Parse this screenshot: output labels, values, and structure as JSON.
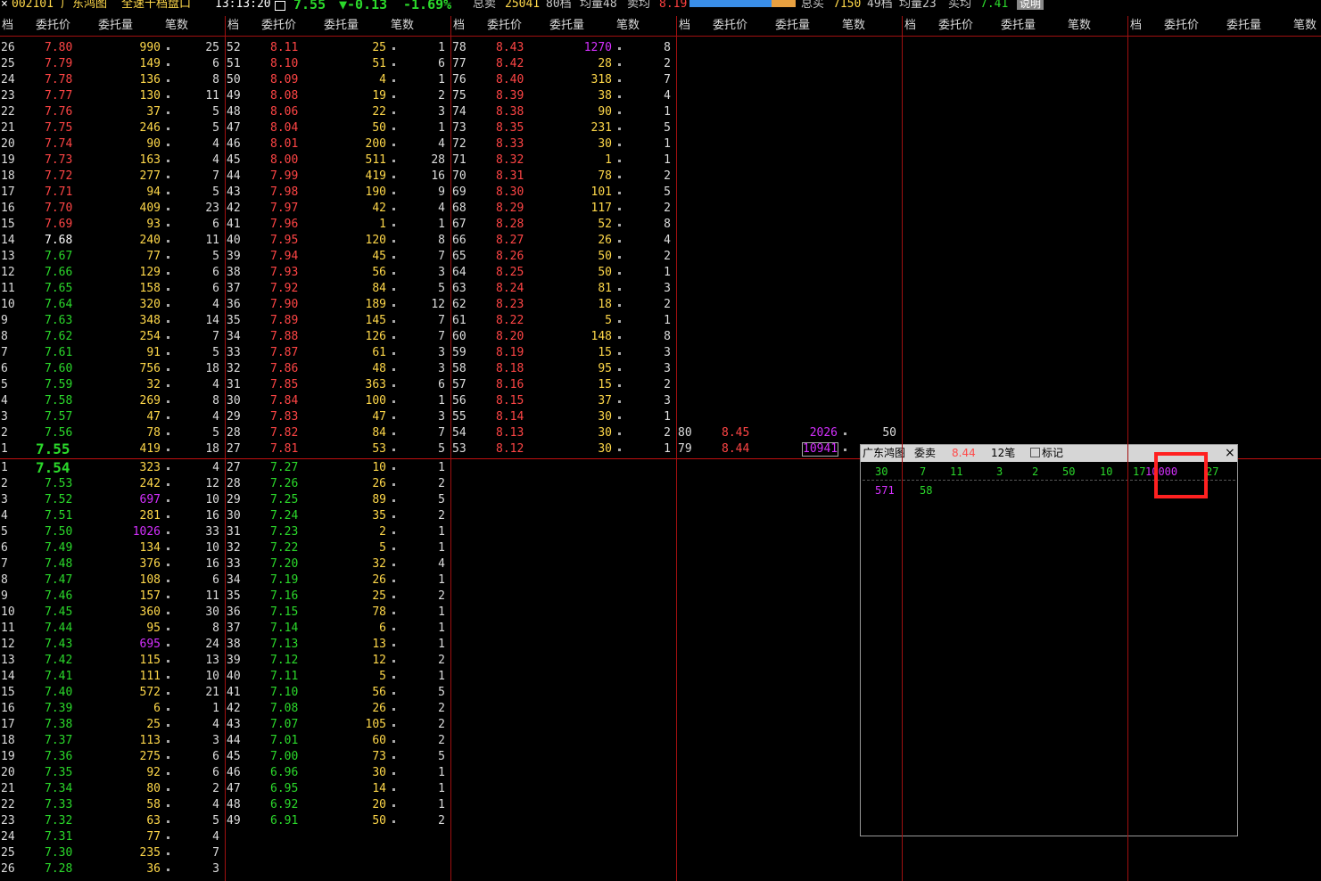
{
  "topbar": {
    "close_glyph": "×",
    "code": "002101",
    "name": "广东鸿图",
    "mode": "全速十档盘口",
    "time": "13:13:20",
    "camera_icon": "camera-icon",
    "price": "7.55",
    "change": "▼-0.13",
    "pct": "-1.69%",
    "sell_label": "总卖",
    "sell_total": "25041",
    "sell_levels": "80档",
    "sell_avg_label": "均量48",
    "sell_avg_price_label": "卖均",
    "sell_avg_price": "8.19",
    "buy_label": "总买",
    "buy_total": "7150",
    "buy_levels": "49档",
    "buy_avg_label": "均量23",
    "buy_avg_price_label": "买均",
    "buy_avg_price": "7.41",
    "help_btn": "说明",
    "bar_blue": "#3a8ee8",
    "bar_orange": "#e8a040"
  },
  "headers": [
    "档",
    "委托价",
    "委托量",
    "笔数"
  ],
  "ask_columns": [
    [
      [
        "26",
        "7.80",
        "990",
        "25",
        "r"
      ],
      [
        "25",
        "7.79",
        "149",
        "6",
        "r"
      ],
      [
        "24",
        "7.78",
        "136",
        "8",
        "r"
      ],
      [
        "23",
        "7.77",
        "130",
        "11",
        "r"
      ],
      [
        "22",
        "7.76",
        "37",
        "5",
        "r"
      ],
      [
        "21",
        "7.75",
        "246",
        "5",
        "r"
      ],
      [
        "20",
        "7.74",
        "90",
        "4",
        "r"
      ],
      [
        "19",
        "7.73",
        "163",
        "4",
        "r"
      ],
      [
        "18",
        "7.72",
        "277",
        "7",
        "r"
      ],
      [
        "17",
        "7.71",
        "94",
        "5",
        "r"
      ],
      [
        "16",
        "7.70",
        "409",
        "23",
        "r"
      ],
      [
        "15",
        "7.69",
        "93",
        "6",
        "r"
      ],
      [
        "14",
        "7.68",
        "240",
        "11",
        "w"
      ],
      [
        "13",
        "7.67",
        "77",
        "5",
        "g"
      ],
      [
        "12",
        "7.66",
        "129",
        "6",
        "g"
      ],
      [
        "11",
        "7.65",
        "158",
        "6",
        "g"
      ],
      [
        "10",
        "7.64",
        "320",
        "4",
        "g"
      ],
      [
        "9",
        "7.63",
        "348",
        "14",
        "g"
      ],
      [
        "8",
        "7.62",
        "254",
        "7",
        "g"
      ],
      [
        "7",
        "7.61",
        "91",
        "5",
        "g"
      ],
      [
        "6",
        "7.60",
        "756",
        "18",
        "g"
      ],
      [
        "5",
        "7.59",
        "32",
        "4",
        "g"
      ],
      [
        "4",
        "7.58",
        "269",
        "8",
        "g"
      ],
      [
        "3",
        "7.57",
        "47",
        "4",
        "g"
      ],
      [
        "2",
        "7.56",
        "78",
        "5",
        "g"
      ],
      [
        "1",
        "7.55",
        "419",
        "18",
        "gb"
      ]
    ],
    [
      [
        "52",
        "8.11",
        "25",
        "1",
        "r"
      ],
      [
        "51",
        "8.10",
        "51",
        "6",
        "r"
      ],
      [
        "50",
        "8.09",
        "4",
        "1",
        "r"
      ],
      [
        "49",
        "8.08",
        "19",
        "2",
        "r"
      ],
      [
        "48",
        "8.06",
        "22",
        "3",
        "r"
      ],
      [
        "47",
        "8.04",
        "50",
        "1",
        "r"
      ],
      [
        "46",
        "8.01",
        "200",
        "4",
        "r"
      ],
      [
        "45",
        "8.00",
        "511",
        "28",
        "r"
      ],
      [
        "44",
        "7.99",
        "419",
        "16",
        "r"
      ],
      [
        "43",
        "7.98",
        "190",
        "9",
        "r"
      ],
      [
        "42",
        "7.97",
        "42",
        "4",
        "r"
      ],
      [
        "41",
        "7.96",
        "1",
        "1",
        "r"
      ],
      [
        "40",
        "7.95",
        "120",
        "8",
        "r"
      ],
      [
        "39",
        "7.94",
        "45",
        "7",
        "r"
      ],
      [
        "38",
        "7.93",
        "56",
        "3",
        "r"
      ],
      [
        "37",
        "7.92",
        "84",
        "5",
        "r"
      ],
      [
        "36",
        "7.90",
        "189",
        "12",
        "r"
      ],
      [
        "35",
        "7.89",
        "145",
        "7",
        "r"
      ],
      [
        "34",
        "7.88",
        "126",
        "7",
        "r"
      ],
      [
        "33",
        "7.87",
        "61",
        "3",
        "r"
      ],
      [
        "32",
        "7.86",
        "48",
        "3",
        "r"
      ],
      [
        "31",
        "7.85",
        "363",
        "6",
        "r"
      ],
      [
        "30",
        "7.84",
        "100",
        "1",
        "r"
      ],
      [
        "29",
        "7.83",
        "47",
        "3",
        "r"
      ],
      [
        "28",
        "7.82",
        "84",
        "7",
        "r"
      ],
      [
        "27",
        "7.81",
        "53",
        "5",
        "r"
      ]
    ],
    [
      [
        "78",
        "8.43",
        "1270",
        "8",
        "r"
      ],
      [
        "77",
        "8.42",
        "28",
        "2",
        "r"
      ],
      [
        "76",
        "8.40",
        "318",
        "7",
        "r"
      ],
      [
        "75",
        "8.39",
        "38",
        "4",
        "r"
      ],
      [
        "74",
        "8.38",
        "90",
        "1",
        "r"
      ],
      [
        "73",
        "8.35",
        "231",
        "5",
        "r"
      ],
      [
        "72",
        "8.33",
        "30",
        "1",
        "r"
      ],
      [
        "71",
        "8.32",
        "1",
        "1",
        "r"
      ],
      [
        "70",
        "8.31",
        "78",
        "2",
        "r"
      ],
      [
        "69",
        "8.30",
        "101",
        "5",
        "r"
      ],
      [
        "68",
        "8.29",
        "117",
        "2",
        "r"
      ],
      [
        "67",
        "8.28",
        "52",
        "8",
        "r"
      ],
      [
        "66",
        "8.27",
        "26",
        "4",
        "r"
      ],
      [
        "65",
        "8.26",
        "50",
        "2",
        "r"
      ],
      [
        "64",
        "8.25",
        "50",
        "1",
        "r"
      ],
      [
        "63",
        "8.24",
        "81",
        "3",
        "r"
      ],
      [
        "62",
        "8.23",
        "18",
        "2",
        "r"
      ],
      [
        "61",
        "8.22",
        "5",
        "1",
        "r"
      ],
      [
        "60",
        "8.20",
        "148",
        "8",
        "r"
      ],
      [
        "59",
        "8.19",
        "15",
        "3",
        "r"
      ],
      [
        "58",
        "8.18",
        "95",
        "3",
        "r"
      ],
      [
        "57",
        "8.16",
        "15",
        "2",
        "r"
      ],
      [
        "56",
        "8.15",
        "37",
        "3",
        "r"
      ],
      [
        "55",
        "8.14",
        "30",
        "1",
        "r"
      ],
      [
        "54",
        "8.13",
        "30",
        "2",
        "r"
      ],
      [
        "53",
        "8.12",
        "30",
        "1",
        "r"
      ]
    ],
    [
      [
        "80",
        "8.45",
        "2026",
        "50",
        "r"
      ],
      [
        "79",
        "8.44",
        "10941",
        "",
        "r"
      ]
    ]
  ],
  "bid_columns": [
    [
      [
        "1",
        "7.54",
        "323",
        "4",
        "gb"
      ],
      [
        "2",
        "7.53",
        "242",
        "12",
        "g"
      ],
      [
        "3",
        "7.52",
        "697",
        "10",
        "g"
      ],
      [
        "4",
        "7.51",
        "281",
        "16",
        "g"
      ],
      [
        "5",
        "7.50",
        "1026",
        "33",
        "g"
      ],
      [
        "6",
        "7.49",
        "134",
        "10",
        "g"
      ],
      [
        "7",
        "7.48",
        "376",
        "16",
        "g"
      ],
      [
        "8",
        "7.47",
        "108",
        "6",
        "g"
      ],
      [
        "9",
        "7.46",
        "157",
        "11",
        "g"
      ],
      [
        "10",
        "7.45",
        "360",
        "30",
        "g"
      ],
      [
        "11",
        "7.44",
        "95",
        "8",
        "g"
      ],
      [
        "12",
        "7.43",
        "695",
        "24",
        "g"
      ],
      [
        "13",
        "7.42",
        "115",
        "13",
        "g"
      ],
      [
        "14",
        "7.41",
        "111",
        "10",
        "g"
      ],
      [
        "15",
        "7.40",
        "572",
        "21",
        "g"
      ],
      [
        "16",
        "7.39",
        "6",
        "1",
        "g"
      ],
      [
        "17",
        "7.38",
        "25",
        "4",
        "g"
      ],
      [
        "18",
        "7.37",
        "113",
        "3",
        "g"
      ],
      [
        "19",
        "7.36",
        "275",
        "6",
        "g"
      ],
      [
        "20",
        "7.35",
        "92",
        "6",
        "g"
      ],
      [
        "21",
        "7.34",
        "80",
        "2",
        "g"
      ],
      [
        "22",
        "7.33",
        "58",
        "4",
        "g"
      ],
      [
        "23",
        "7.32",
        "63",
        "5",
        "g"
      ],
      [
        "24",
        "7.31",
        "77",
        "4",
        "g"
      ],
      [
        "25",
        "7.30",
        "235",
        "7",
        "g"
      ],
      [
        "26",
        "7.28",
        "36",
        "3",
        "g"
      ]
    ],
    [
      [
        "27",
        "7.27",
        "10",
        "1",
        "g"
      ],
      [
        "28",
        "7.26",
        "26",
        "2",
        "g"
      ],
      [
        "29",
        "7.25",
        "89",
        "5",
        "g"
      ],
      [
        "30",
        "7.24",
        "35",
        "2",
        "g"
      ],
      [
        "31",
        "7.23",
        "2",
        "1",
        "g"
      ],
      [
        "32",
        "7.22",
        "5",
        "1",
        "g"
      ],
      [
        "33",
        "7.20",
        "32",
        "4",
        "g"
      ],
      [
        "34",
        "7.19",
        "26",
        "1",
        "g"
      ],
      [
        "35",
        "7.16",
        "25",
        "2",
        "g"
      ],
      [
        "36",
        "7.15",
        "78",
        "1",
        "g"
      ],
      [
        "37",
        "7.14",
        "6",
        "1",
        "g"
      ],
      [
        "38",
        "7.13",
        "13",
        "1",
        "g"
      ],
      [
        "39",
        "7.12",
        "12",
        "2",
        "g"
      ],
      [
        "40",
        "7.11",
        "5",
        "1",
        "g"
      ],
      [
        "41",
        "7.10",
        "56",
        "5",
        "g"
      ],
      [
        "42",
        "7.08",
        "26",
        "2",
        "g"
      ],
      [
        "43",
        "7.07",
        "105",
        "2",
        "g"
      ],
      [
        "44",
        "7.01",
        "60",
        "2",
        "g"
      ],
      [
        "45",
        "7.00",
        "73",
        "5",
        "g"
      ],
      [
        "46",
        "6.96",
        "30",
        "1",
        "g"
      ],
      [
        "47",
        "6.95",
        "14",
        "1",
        "g"
      ],
      [
        "48",
        "6.92",
        "20",
        "1",
        "g"
      ],
      [
        "49",
        "6.91",
        "50",
        "2",
        "g"
      ]
    ]
  ],
  "highlight_vol": [
    "1270",
    "1026",
    "697",
    "695",
    "2026",
    "10941"
  ],
  "popup": {
    "name": "广东鸿图",
    "type": "委卖",
    "price": "8.44",
    "count": "12笔",
    "mark": "标记",
    "close": "×",
    "row1": [
      "30",
      "7",
      "11",
      "3",
      "2",
      "50",
      "10",
      "17",
      "10000",
      "27"
    ],
    "row2": [
      "571",
      "58"
    ]
  }
}
